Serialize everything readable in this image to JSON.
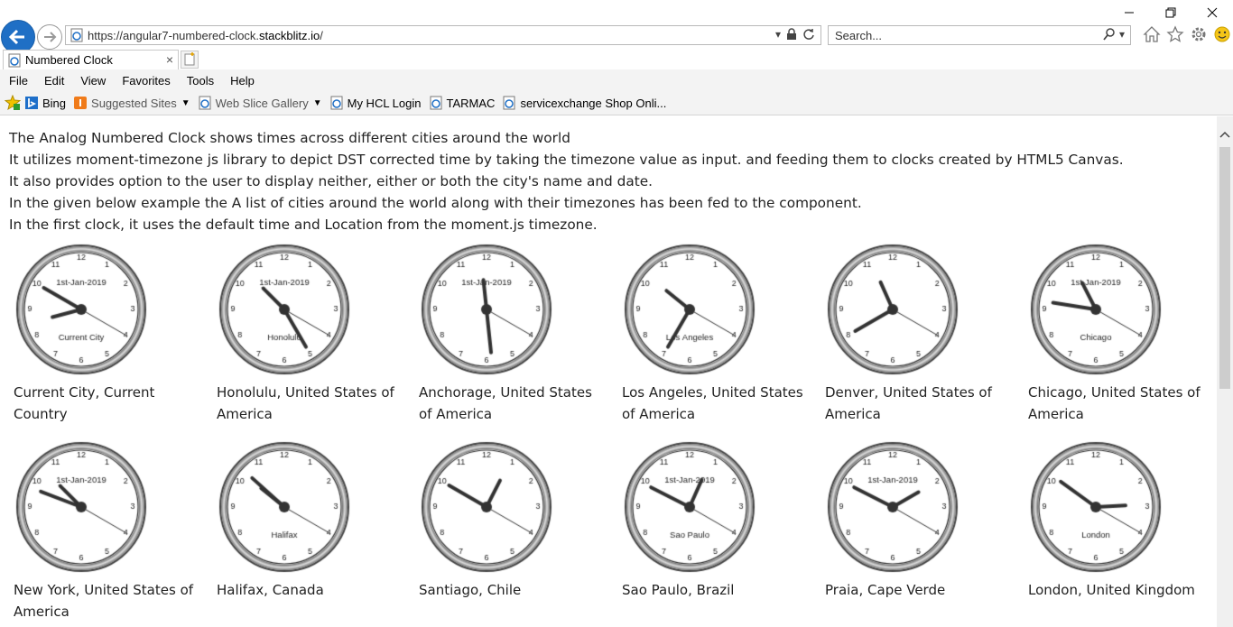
{
  "browser": {
    "address": "https://angular7-numbered-clock.stackblitz.io/",
    "address_prefix": "https://angular7-numbered-clock.",
    "address_domain": "stackblitz.io",
    "address_suffix": "/",
    "search_placeholder": "Search...",
    "tab_title": "Numbered Clock",
    "menu": [
      "File",
      "Edit",
      "View",
      "Favorites",
      "Tools",
      "Help"
    ],
    "favorites": [
      {
        "label": "Bing",
        "icon": "bing-icon"
      },
      {
        "label": "Suggested Sites",
        "icon": "suggested-sites-icon",
        "dropdown": true
      },
      {
        "label": "Web Slice Gallery",
        "icon": "web-slice-icon",
        "dropdown": true
      },
      {
        "label": "My HCL Login",
        "icon": "ie-page-icon"
      },
      {
        "label": "TARMAC",
        "icon": "ie-page-icon"
      },
      {
        "label": "servicexchange Shop Onli...",
        "icon": "ie-page-icon"
      }
    ]
  },
  "intro": [
    "The Analog Numbered Clock shows times across different cities around the world",
    "It utilizes moment-timezone js library to depict DST corrected time by taking the timezone value as input. and feeding them to clocks created by HTML5 Canvas.",
    "It also provides option to the user to display neither, either or both the city's name and date.",
    "In the given below example the A list of cities around the world along with their timezones has been fed to the component.",
    "In the first clock, it uses the default time and Location from the moment.js timezone."
  ],
  "clocks": [
    {
      "label": "Current City, Current Country",
      "city": "Current City",
      "date": "1st-Jan-2019",
      "hour": 8.5,
      "minute": 50,
      "second": 20
    },
    {
      "label": "Honolulu, United States of America",
      "city": "Honolulu",
      "date": "1st-Jan-2019",
      "hour": 10.5,
      "minute": 25,
      "second": 20
    },
    {
      "label": "Anchorage, United States of America",
      "city": "",
      "date": "1st-Jan-2019",
      "hour": 11.8,
      "minute": 29,
      "second": 20
    },
    {
      "label": "Los Angeles, United States of America",
      "city": "Los Angeles",
      "date": "",
      "hour": 10.3,
      "minute": 35,
      "second": 20
    },
    {
      "label": "Denver, United States of America",
      "city": "",
      "date": "",
      "hour": 11.2,
      "minute": 40,
      "second": 20
    },
    {
      "label": "Chicago, United States of America",
      "city": "Chicago",
      "date": "1st-Jan-2019",
      "hour": 11.1,
      "minute": 46.5,
      "second": 20
    },
    {
      "label": "New York, United States of America",
      "city": "",
      "date": "1st-Jan-2019",
      "hour": 10.5,
      "minute": 48.5,
      "second": 20
    },
    {
      "label": "Halifax, Canada",
      "city": "Halifax",
      "date": "",
      "hour": 10.3,
      "minute": 52,
      "second": 20
    },
    {
      "label": "Santiago, Chile",
      "city": "",
      "date": "",
      "hour": 12.9,
      "minute": 50,
      "second": 20
    },
    {
      "label": "Sao Paulo, Brazil",
      "city": "Sao Paulo",
      "date": "1st-Jan-2019",
      "hour": 12.8,
      "minute": 49.5,
      "second": 20
    },
    {
      "label": "Praia, Cape Verde",
      "city": "",
      "date": "1st-Jan-2019",
      "hour": 2,
      "minute": 49.5,
      "second": 20
    },
    {
      "label": "London, United Kingdom",
      "city": "London",
      "date": "",
      "hour": 2.9,
      "minute": 51,
      "second": 20
    }
  ],
  "colors": {
    "accent": "#1f6fc5",
    "hand": "#333333",
    "clock_ring": "#555555"
  }
}
